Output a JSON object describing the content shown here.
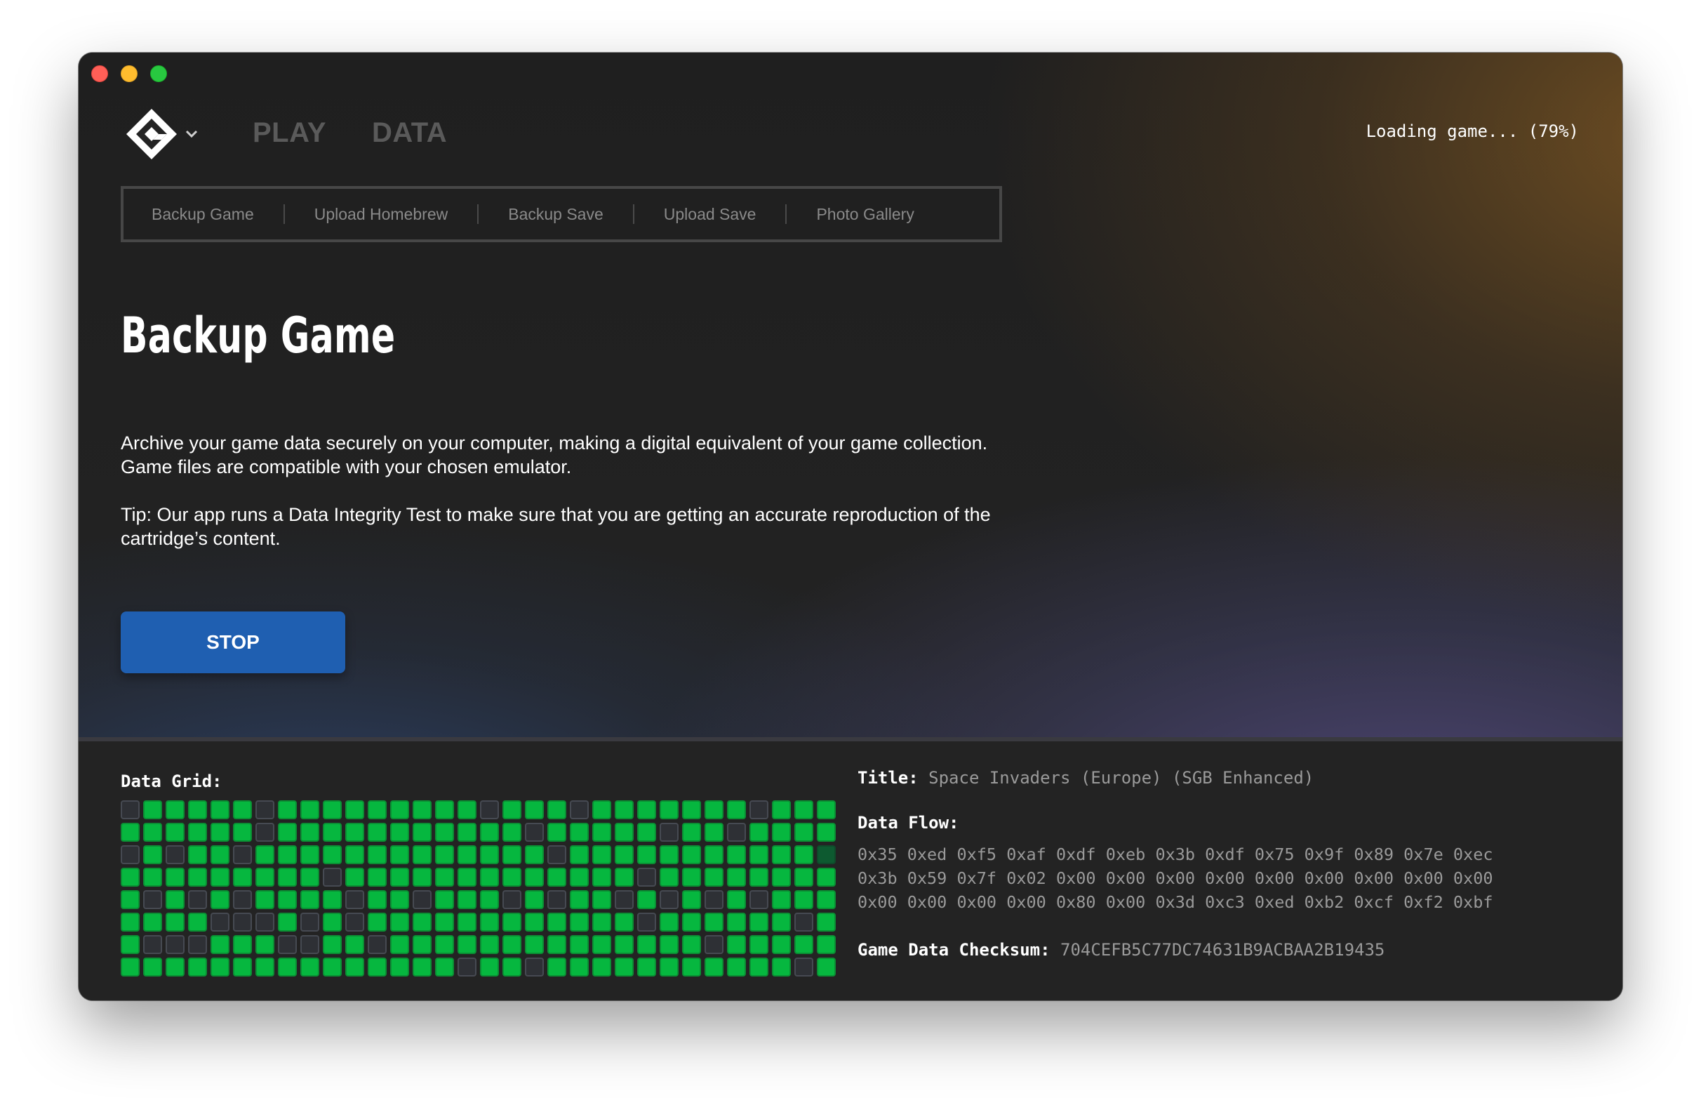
{
  "header": {
    "logo_icon": "cube-logo-icon",
    "menu_chevron_icon": "chevron-down-icon",
    "nav": [
      {
        "label": "PLAY"
      },
      {
        "label": "DATA"
      }
    ],
    "status": "Loading game... (79%)",
    "progress_percent": 79
  },
  "subnav": {
    "items": [
      {
        "label": "Backup Game"
      },
      {
        "label": "Upload Homebrew"
      },
      {
        "label": "Backup Save"
      },
      {
        "label": "Upload Save"
      },
      {
        "label": "Photo Gallery"
      }
    ]
  },
  "main": {
    "title": "Backup Game",
    "description": "Archive your game data securely on your computer, making a digital equivalent of your game collection. Game files are compatible with your chosen emulator.",
    "tip": "Tip: Our app runs a Data Integrity Test to make sure that you are getting an accurate reproduction of the cartridge’s content.",
    "stop_label": "STOP"
  },
  "data_panel": {
    "grid_label": "Data Grid:",
    "grid_rows": [
      "01111101111111110111011111110111",
      "11111101111111111101111101101111",
      "01011011111111111110111111111112",
      "11111111101111111111111011111111",
      "10101011110110111010110101010111",
      "11110001010111111111111011111101",
      "10001110011011111111111111011111",
      "11111111111111101101111111111101"
    ],
    "title_key": "Title:",
    "title_value": "Space Invaders (Europe) (SGB Enhanced)",
    "flow_key": "Data Flow:",
    "flow_lines": [
      "0x35 0xed 0xf5 0xaf 0xdf 0xeb 0x3b 0xdf 0x75 0x9f 0x89 0x7e 0xec",
      "0x3b 0x59 0x7f 0x02 0x00 0x00 0x00 0x00 0x00 0x00 0x00 0x00 0x00",
      "0x00 0x00 0x00 0x00 0x80 0x00 0x3d 0xc3 0xed 0xb2 0xcf 0xf2 0xbf"
    ],
    "checksum_key": "Game Data Checksum:",
    "checksum_value": "704CEFB5C77DC74631B9ACBAA2B19435"
  },
  "colors": {
    "accent_button": "#1f5fb1",
    "grid_ok": "#06b73f",
    "grid_empty": "#2e3035"
  }
}
